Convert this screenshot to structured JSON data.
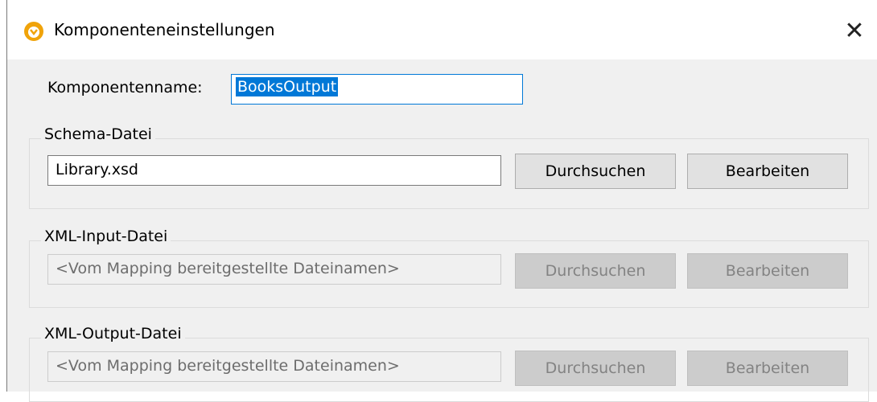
{
  "window": {
    "title": "Komponenteneinstellungen",
    "app_icon": "altova-mapforce-icon",
    "close_label": "✕"
  },
  "component": {
    "name_label": "Komponentenname:",
    "name_value": "BooksOutput"
  },
  "groups": {
    "schema": {
      "legend": "Schema-Datei",
      "file_value": "Library.xsd",
      "browse_label": "Durchsuchen",
      "edit_label": "Bearbeiten",
      "enabled": true
    },
    "xml_input": {
      "legend": "XML-Input-Datei",
      "file_value": "<Vom Mapping bereitgestellte Dateinamen>",
      "browse_label": "Durchsuchen",
      "edit_label": "Bearbeiten",
      "enabled": false
    },
    "xml_output": {
      "legend": "XML-Output-Datei",
      "file_value": "<Vom Mapping bereitgestellte Dateinamen>",
      "browse_label": "Durchsuchen",
      "edit_label": "Bearbeiten",
      "enabled": false
    }
  },
  "colors": {
    "accent": "#0078d7",
    "icon_orange": "#f0a30a"
  }
}
